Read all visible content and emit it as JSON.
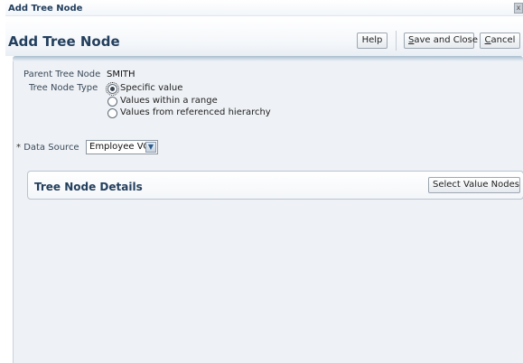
{
  "window": {
    "title": "Add Tree Node",
    "close_glyph": "x"
  },
  "header": {
    "title": "Add Tree Node",
    "help_label": "Help",
    "save_close_label": "Save and Close",
    "cancel_label": "Cancel"
  },
  "form": {
    "parent_tree_node_label": "Parent Tree Node",
    "parent_tree_node_value": "SMITH",
    "tree_node_type_label": "Tree Node Type",
    "tree_node_type_options": [
      "Specific value",
      "Values within a range",
      "Values from referenced hierarchy"
    ],
    "tree_node_type_selected": "Specific value",
    "required_marker": "*",
    "data_source_label": "Data Source",
    "data_source_value": "Employee VO"
  },
  "details": {
    "title": "Tree Node Details",
    "select_value_nodes_label": "Select Value Nodes"
  },
  "colors": {
    "heading": "#233f5e",
    "content_bg": "#eef1f5",
    "accent_band": "#a9bccf"
  },
  "icons": {
    "close": "close-icon",
    "dropdown": "chevron-down-icon"
  }
}
